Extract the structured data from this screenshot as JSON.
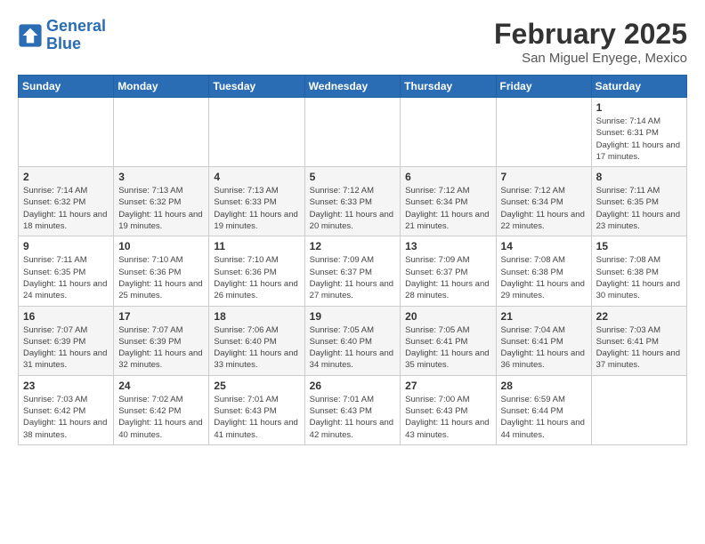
{
  "logo": {
    "line1": "General",
    "line2": "Blue"
  },
  "title": "February 2025",
  "location": "San Miguel Enyege, Mexico",
  "weekdays": [
    "Sunday",
    "Monday",
    "Tuesday",
    "Wednesday",
    "Thursday",
    "Friday",
    "Saturday"
  ],
  "weeks": [
    [
      {
        "day": "",
        "info": ""
      },
      {
        "day": "",
        "info": ""
      },
      {
        "day": "",
        "info": ""
      },
      {
        "day": "",
        "info": ""
      },
      {
        "day": "",
        "info": ""
      },
      {
        "day": "",
        "info": ""
      },
      {
        "day": "1",
        "info": "Sunrise: 7:14 AM\nSunset: 6:31 PM\nDaylight: 11 hours and 17 minutes."
      }
    ],
    [
      {
        "day": "2",
        "info": "Sunrise: 7:14 AM\nSunset: 6:32 PM\nDaylight: 11 hours and 18 minutes."
      },
      {
        "day": "3",
        "info": "Sunrise: 7:13 AM\nSunset: 6:32 PM\nDaylight: 11 hours and 19 minutes."
      },
      {
        "day": "4",
        "info": "Sunrise: 7:13 AM\nSunset: 6:33 PM\nDaylight: 11 hours and 19 minutes."
      },
      {
        "day": "5",
        "info": "Sunrise: 7:12 AM\nSunset: 6:33 PM\nDaylight: 11 hours and 20 minutes."
      },
      {
        "day": "6",
        "info": "Sunrise: 7:12 AM\nSunset: 6:34 PM\nDaylight: 11 hours and 21 minutes."
      },
      {
        "day": "7",
        "info": "Sunrise: 7:12 AM\nSunset: 6:34 PM\nDaylight: 11 hours and 22 minutes."
      },
      {
        "day": "8",
        "info": "Sunrise: 7:11 AM\nSunset: 6:35 PM\nDaylight: 11 hours and 23 minutes."
      }
    ],
    [
      {
        "day": "9",
        "info": "Sunrise: 7:11 AM\nSunset: 6:35 PM\nDaylight: 11 hours and 24 minutes."
      },
      {
        "day": "10",
        "info": "Sunrise: 7:10 AM\nSunset: 6:36 PM\nDaylight: 11 hours and 25 minutes."
      },
      {
        "day": "11",
        "info": "Sunrise: 7:10 AM\nSunset: 6:36 PM\nDaylight: 11 hours and 26 minutes."
      },
      {
        "day": "12",
        "info": "Sunrise: 7:09 AM\nSunset: 6:37 PM\nDaylight: 11 hours and 27 minutes."
      },
      {
        "day": "13",
        "info": "Sunrise: 7:09 AM\nSunset: 6:37 PM\nDaylight: 11 hours and 28 minutes."
      },
      {
        "day": "14",
        "info": "Sunrise: 7:08 AM\nSunset: 6:38 PM\nDaylight: 11 hours and 29 minutes."
      },
      {
        "day": "15",
        "info": "Sunrise: 7:08 AM\nSunset: 6:38 PM\nDaylight: 11 hours and 30 minutes."
      }
    ],
    [
      {
        "day": "16",
        "info": "Sunrise: 7:07 AM\nSunset: 6:39 PM\nDaylight: 11 hours and 31 minutes."
      },
      {
        "day": "17",
        "info": "Sunrise: 7:07 AM\nSunset: 6:39 PM\nDaylight: 11 hours and 32 minutes."
      },
      {
        "day": "18",
        "info": "Sunrise: 7:06 AM\nSunset: 6:40 PM\nDaylight: 11 hours and 33 minutes."
      },
      {
        "day": "19",
        "info": "Sunrise: 7:05 AM\nSunset: 6:40 PM\nDaylight: 11 hours and 34 minutes."
      },
      {
        "day": "20",
        "info": "Sunrise: 7:05 AM\nSunset: 6:41 PM\nDaylight: 11 hours and 35 minutes."
      },
      {
        "day": "21",
        "info": "Sunrise: 7:04 AM\nSunset: 6:41 PM\nDaylight: 11 hours and 36 minutes."
      },
      {
        "day": "22",
        "info": "Sunrise: 7:03 AM\nSunset: 6:41 PM\nDaylight: 11 hours and 37 minutes."
      }
    ],
    [
      {
        "day": "23",
        "info": "Sunrise: 7:03 AM\nSunset: 6:42 PM\nDaylight: 11 hours and 38 minutes."
      },
      {
        "day": "24",
        "info": "Sunrise: 7:02 AM\nSunset: 6:42 PM\nDaylight: 11 hours and 40 minutes."
      },
      {
        "day": "25",
        "info": "Sunrise: 7:01 AM\nSunset: 6:43 PM\nDaylight: 11 hours and 41 minutes."
      },
      {
        "day": "26",
        "info": "Sunrise: 7:01 AM\nSunset: 6:43 PM\nDaylight: 11 hours and 42 minutes."
      },
      {
        "day": "27",
        "info": "Sunrise: 7:00 AM\nSunset: 6:43 PM\nDaylight: 11 hours and 43 minutes."
      },
      {
        "day": "28",
        "info": "Sunrise: 6:59 AM\nSunset: 6:44 PM\nDaylight: 11 hours and 44 minutes."
      },
      {
        "day": "",
        "info": ""
      }
    ]
  ]
}
